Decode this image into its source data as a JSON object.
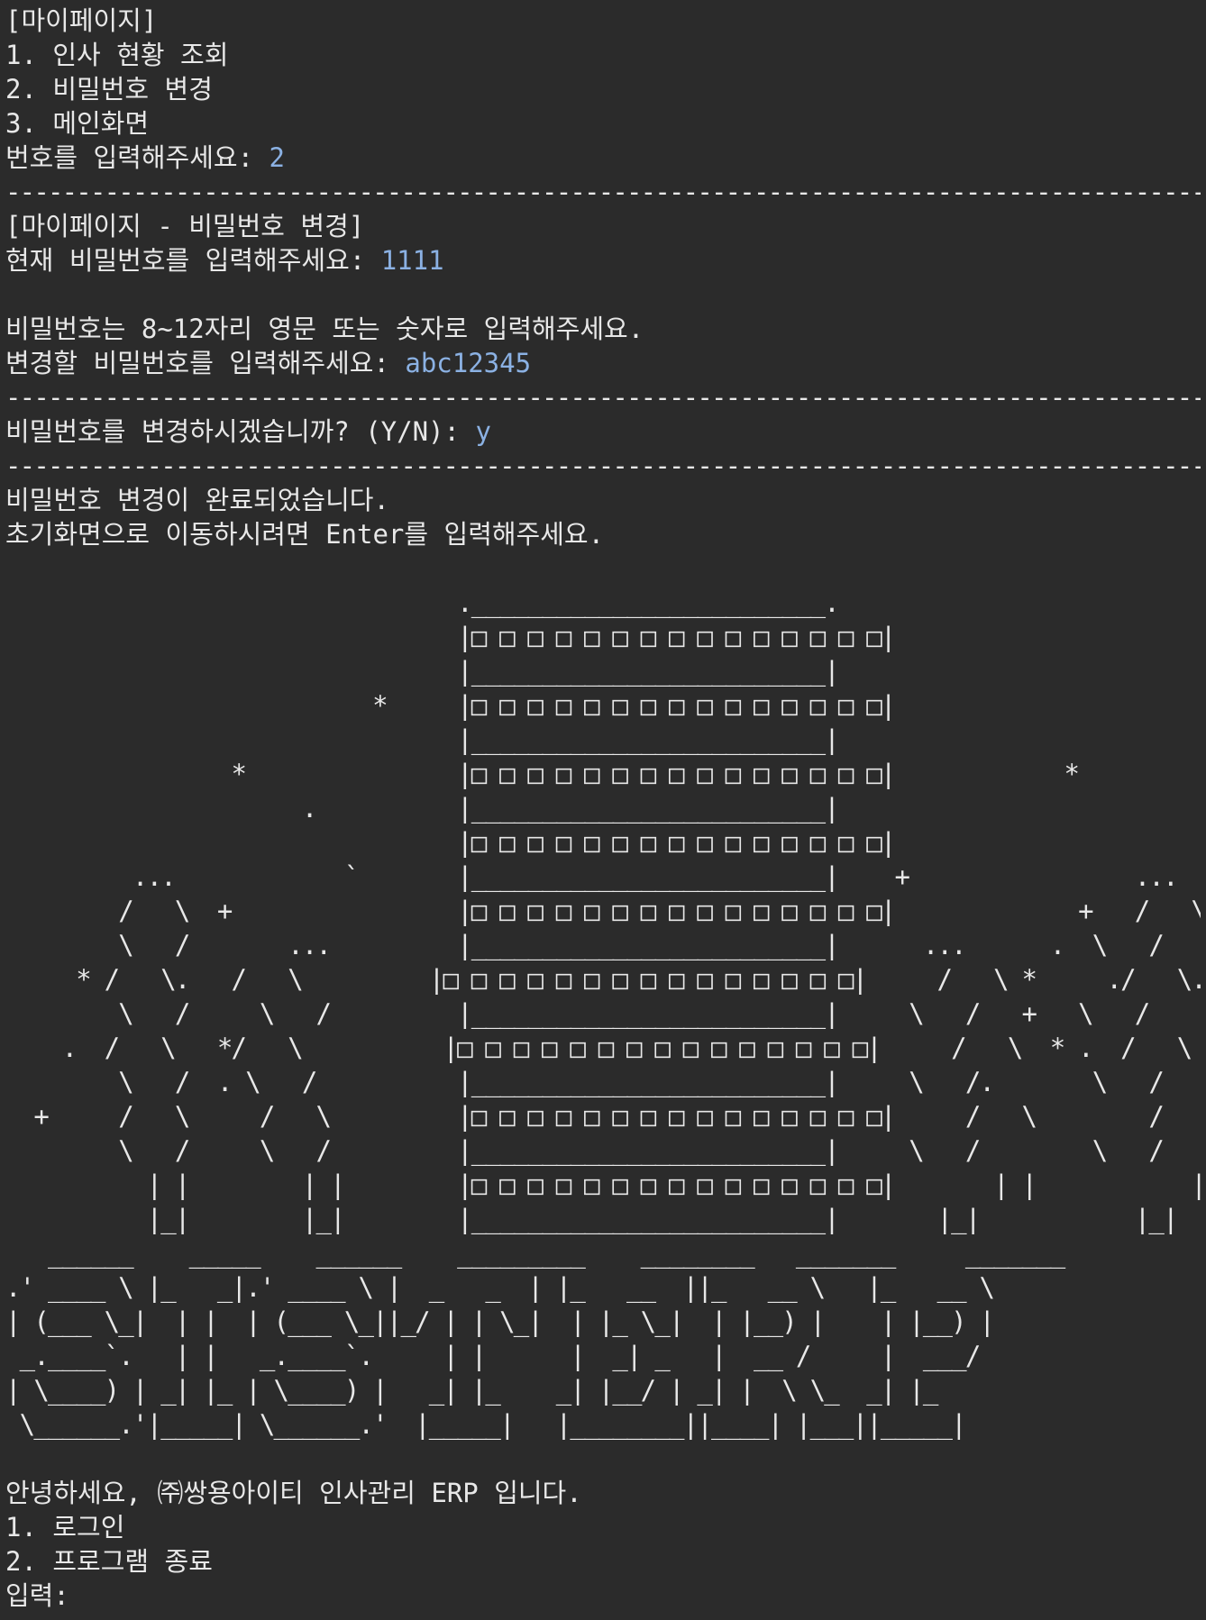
{
  "console": {
    "lines": [
      {
        "kind": "text",
        "text": "[마이페이지]"
      },
      {
        "kind": "text",
        "text": "1. 인사 현황 조회"
      },
      {
        "kind": "text",
        "text": "2. 비밀번호 변경"
      },
      {
        "kind": "text",
        "text": "3. 메인화면"
      },
      {
        "kind": "prompt",
        "prompt": "번호를 입력해주세요: ",
        "input": "2"
      },
      {
        "kind": "sep",
        "text": "---------------------------------------------------------------------------------------------------------------------"
      },
      {
        "kind": "text",
        "text": "[마이페이지 - 비밀번호 변경]"
      },
      {
        "kind": "prompt",
        "prompt": "현재 비밀번호를 입력해주세요: ",
        "input": "1111"
      },
      {
        "kind": "text",
        "text": ""
      },
      {
        "kind": "text",
        "text": "비밀번호는 8~12자리 영문 또는 숫자로 입력해주세요."
      },
      {
        "kind": "prompt",
        "prompt": "변경할 비밀번호를 입력해주세요: ",
        "input": "abc12345"
      },
      {
        "kind": "sep",
        "text": "---------------------------------------------------------------------------------------------------------------------"
      },
      {
        "kind": "prompt",
        "prompt": "비밀번호를 변경하시겠습니까? (Y/N): ",
        "input": "y"
      },
      {
        "kind": "sep",
        "text": "---------------------------------------------------------------------------------------------------------------------"
      },
      {
        "kind": "text",
        "text": "비밀번호 변경이 완료되었습니다."
      },
      {
        "kind": "text",
        "text": "초기화면으로 이동하시려면 Enter를 입력해주세요."
      },
      {
        "kind": "text",
        "text": ""
      },
      {
        "kind": "art",
        "text": "                                ._________________________."
      },
      {
        "kind": "art",
        "text": "                                |□ □ □ □ □ □ □ □ □ □ □ □ □ □ □|"
      },
      {
        "kind": "art",
        "text": "                                |_________________________|"
      },
      {
        "kind": "art",
        "text": "                          *     |□ □ □ □ □ □ □ □ □ □ □ □ □ □ □|"
      },
      {
        "kind": "art",
        "text": "                                |_________________________|"
      },
      {
        "kind": "art",
        "text": "                *               |□ □ □ □ □ □ □ □ □ □ □ □ □ □ □|            *"
      },
      {
        "kind": "art",
        "text": "                     .          |_________________________|"
      },
      {
        "kind": "art",
        "text": "                                |□ □ □ □ □ □ □ □ □ □ □ □ □ □ □|                          *"
      },
      {
        "kind": "art",
        "text": "         ...            `       |_________________________|    +                ..."
      },
      {
        "kind": "art",
        "text": "        /   \\  +                |□ □ □ □ □ □ □ □ □ □ □ □ □ □ □|             +   /   \\"
      },
      {
        "kind": "art",
        "text": "        \\   /       ...         |_________________________|      ...      .  \\   /"
      },
      {
        "kind": "art",
        "text": "     * /   \\.   /   \\         |□ □ □ □ □ □ □ □ □ □ □ □ □ □ □|     /   \\ *     ./   \\."
      },
      {
        "kind": "art",
        "text": "        \\   /     \\   /         |_________________________|     \\   /   +   \\   /    '"
      },
      {
        "kind": "art",
        "text": "    .  /   \\   */   \\          |□ □ □ □ □ □ □ □ □ □ □ □ □ □ □|     /   \\  * .  /   \\"
      },
      {
        "kind": "art",
        "text": "        \\   /  . \\   /          |_________________________|     \\   /.       \\   /"
      },
      {
        "kind": "art",
        "text": "  +     /   \\     /   \\         |□ □ □ □ □ □ □ □ □ □ □ □ □ □ □|     /   \\        /   \\    +"
      },
      {
        "kind": "art",
        "text": "        \\   /     \\   /         |_________________________|     \\   /        \\   /"
      },
      {
        "kind": "art",
        "text": "          | |        | |        |□ □ □ □ □ □ □ □ □ □ □ □ □ □ □|       | |           | |"
      },
      {
        "kind": "art",
        "text": "          |_|        |_|        |_________________________|       |_|           |_|"
      },
      {
        "kind": "banner",
        "text": "   ______    _____    ______    _________    ________   _______     _______"
      },
      {
        "kind": "banner",
        "text": ".' ____ \\ |_   _|.' ____ \\ |  _   _  | |_   __  ||_   __ \\   |_   __ \\"
      },
      {
        "kind": "banner",
        "text": "| (___ \\_|  | |  | (___ \\_||_/ | | \\_|  | |_ \\_|  | |__) |    | |__) |"
      },
      {
        "kind": "banner",
        "text": " _.____`.   | |   _.____`.     | |      |  _| _   |  __ /     |  ___/"
      },
      {
        "kind": "banner",
        "text": "| \\____) | _| |_ | \\____) |   _| |_    _| |__/ | _| |  \\ \\_  _| |_"
      },
      {
        "kind": "banner",
        "text": " \\______.'|_____| \\______.'  |_____|   |________||____| |___||_____|"
      },
      {
        "kind": "text",
        "text": ""
      },
      {
        "kind": "text",
        "text": "안녕하세요, ㈜쌍용아이티 인사관리 ERP 입니다."
      },
      {
        "kind": "text",
        "text": "1. 로그인"
      },
      {
        "kind": "text",
        "text": "2. 프로그램 종료"
      },
      {
        "kind": "prompt",
        "prompt": "입력: ",
        "input": ""
      }
    ]
  }
}
